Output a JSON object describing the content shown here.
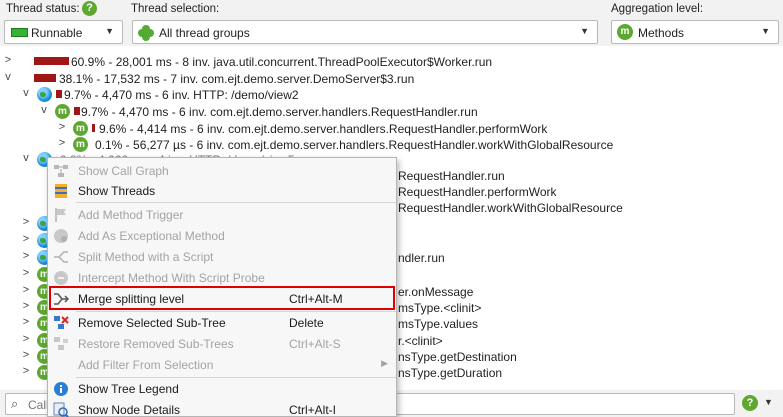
{
  "toolbar": {
    "thread_status_label": "Thread status:",
    "thread_status_value": "Runnable",
    "thread_selection_label": "Thread selection:",
    "thread_selection_value": "All thread groups",
    "aggregation_label": "Aggregation level:",
    "aggregation_value": "Methods",
    "help_icon_text": "?",
    "method_icon_letter": "m"
  },
  "colors": {
    "accent_green": "#5ea832",
    "hotspot_bar": "#a01616",
    "highlight_border": "#e00000",
    "runnable_green": "#34b234"
  },
  "tree": {
    "rows": [
      {
        "text": "60.9% - 28,001 ms - 8 inv. java.util.concurrent.ThreadPoolExecutor$Worker.run",
        "percent": 60.9,
        "icon": "bar-only",
        "expander": ">"
      },
      {
        "text": "38.1% - 17,532 ms - 7 inv. com.ejt.demo.server.DemoServer$3.run",
        "percent": 38.1,
        "icon": "bar-only",
        "expander": "v"
      },
      {
        "text": "9.7% - 4,470 ms - 6 inv. HTTP: /demo/view2",
        "percent": 9.7,
        "icon": "globe",
        "expander": "v"
      },
      {
        "text": "9.7% - 4,470 ms - 6 inv. com.ejt.demo.server.handlers.RequestHandler.run",
        "percent": 9.7,
        "icon": "method",
        "expander": "v"
      },
      {
        "text": "9.6% - 4,414 ms - 6 inv. com.ejt.demo.server.handlers.RequestHandler.performWork",
        "percent": 9.6,
        "icon": "method",
        "expander": ">"
      },
      {
        "text": "0.1% - 56,277 µs - 6 inv. com.ejt.demo.server.handlers.RequestHandler.workWithGlobalResource",
        "percent": 0.1,
        "icon": "method",
        "expander": ">"
      },
      {
        "text": "9.8% - 4,066 ms - 4 inv. HTTP: /demo/view5",
        "percent": 9.8,
        "icon": "globe",
        "expander": "v"
      },
      {
        "text": "RequestHandler.run",
        "icon": "method",
        "expander": ""
      },
      {
        "text": "RequestHandler.performWork",
        "icon": "method",
        "expander": ""
      },
      {
        "text": "RequestHandler.workWithGlobalResource",
        "icon": "method",
        "expander": ""
      },
      {
        "text": "",
        "icon": "globe",
        "expander": ">"
      },
      {
        "text": "",
        "icon": "globe",
        "expander": ">"
      },
      {
        "text": "ndler.run",
        "icon": "globe",
        "expander": ">"
      },
      {
        "text": "",
        "icon": "method",
        "expander": ">"
      },
      {
        "text": "er.onMessage",
        "icon": "method",
        "expander": ">"
      },
      {
        "text": "msType.<clinit>",
        "icon": "method",
        "expander": ">"
      },
      {
        "text": "msType.values",
        "icon": "method",
        "expander": ">"
      },
      {
        "text": "r.<clinit>",
        "icon": "method",
        "expander": ">"
      },
      {
        "text": "nsType.getDestination",
        "icon": "method",
        "expander": ">"
      },
      {
        "text": "nsType.getDuration",
        "icon": "method",
        "expander": ">"
      }
    ]
  },
  "search": {
    "placeholder": "Call",
    "help_text": "?"
  },
  "context_menu": {
    "items": [
      {
        "label": "Show Call Graph",
        "accelerator": "",
        "disabled": true,
        "icon": "call-graph-icon"
      },
      {
        "label": "Show Threads",
        "accelerator": "",
        "disabled": false,
        "icon": "threads-icon"
      },
      {
        "label": "Add Method Trigger",
        "accelerator": "",
        "disabled": true,
        "icon": "flag-icon"
      },
      {
        "label": "Add As Exceptional Method",
        "accelerator": "",
        "disabled": true,
        "icon": "exceptional-method-icon"
      },
      {
        "label": "Split Method with a Script",
        "accelerator": "",
        "disabled": true,
        "icon": "split-icon"
      },
      {
        "label": "Intercept Method With Script Probe",
        "accelerator": "",
        "disabled": true,
        "icon": "probe-icon"
      },
      {
        "label": "Merge splitting level",
        "accelerator": "Ctrl+Alt-M",
        "disabled": false,
        "icon": "merge-icon"
      },
      {
        "label": "Remove Selected Sub-Tree",
        "accelerator": "Delete",
        "disabled": false,
        "icon": "remove-subtree-icon"
      },
      {
        "label": "Restore Removed Sub-Trees",
        "accelerator": "Ctrl+Alt-S",
        "disabled": true,
        "icon": "restore-icon"
      },
      {
        "label": "Add Filter From Selection",
        "accelerator": "",
        "disabled": true,
        "icon": "filter-icon",
        "submenu": true
      },
      {
        "label": "Show Tree Legend",
        "accelerator": "",
        "disabled": false,
        "icon": "info-icon"
      },
      {
        "label": "Show Node Details",
        "accelerator": "Ctrl+Alt-I",
        "disabled": false,
        "icon": "node-details-icon"
      }
    ]
  }
}
